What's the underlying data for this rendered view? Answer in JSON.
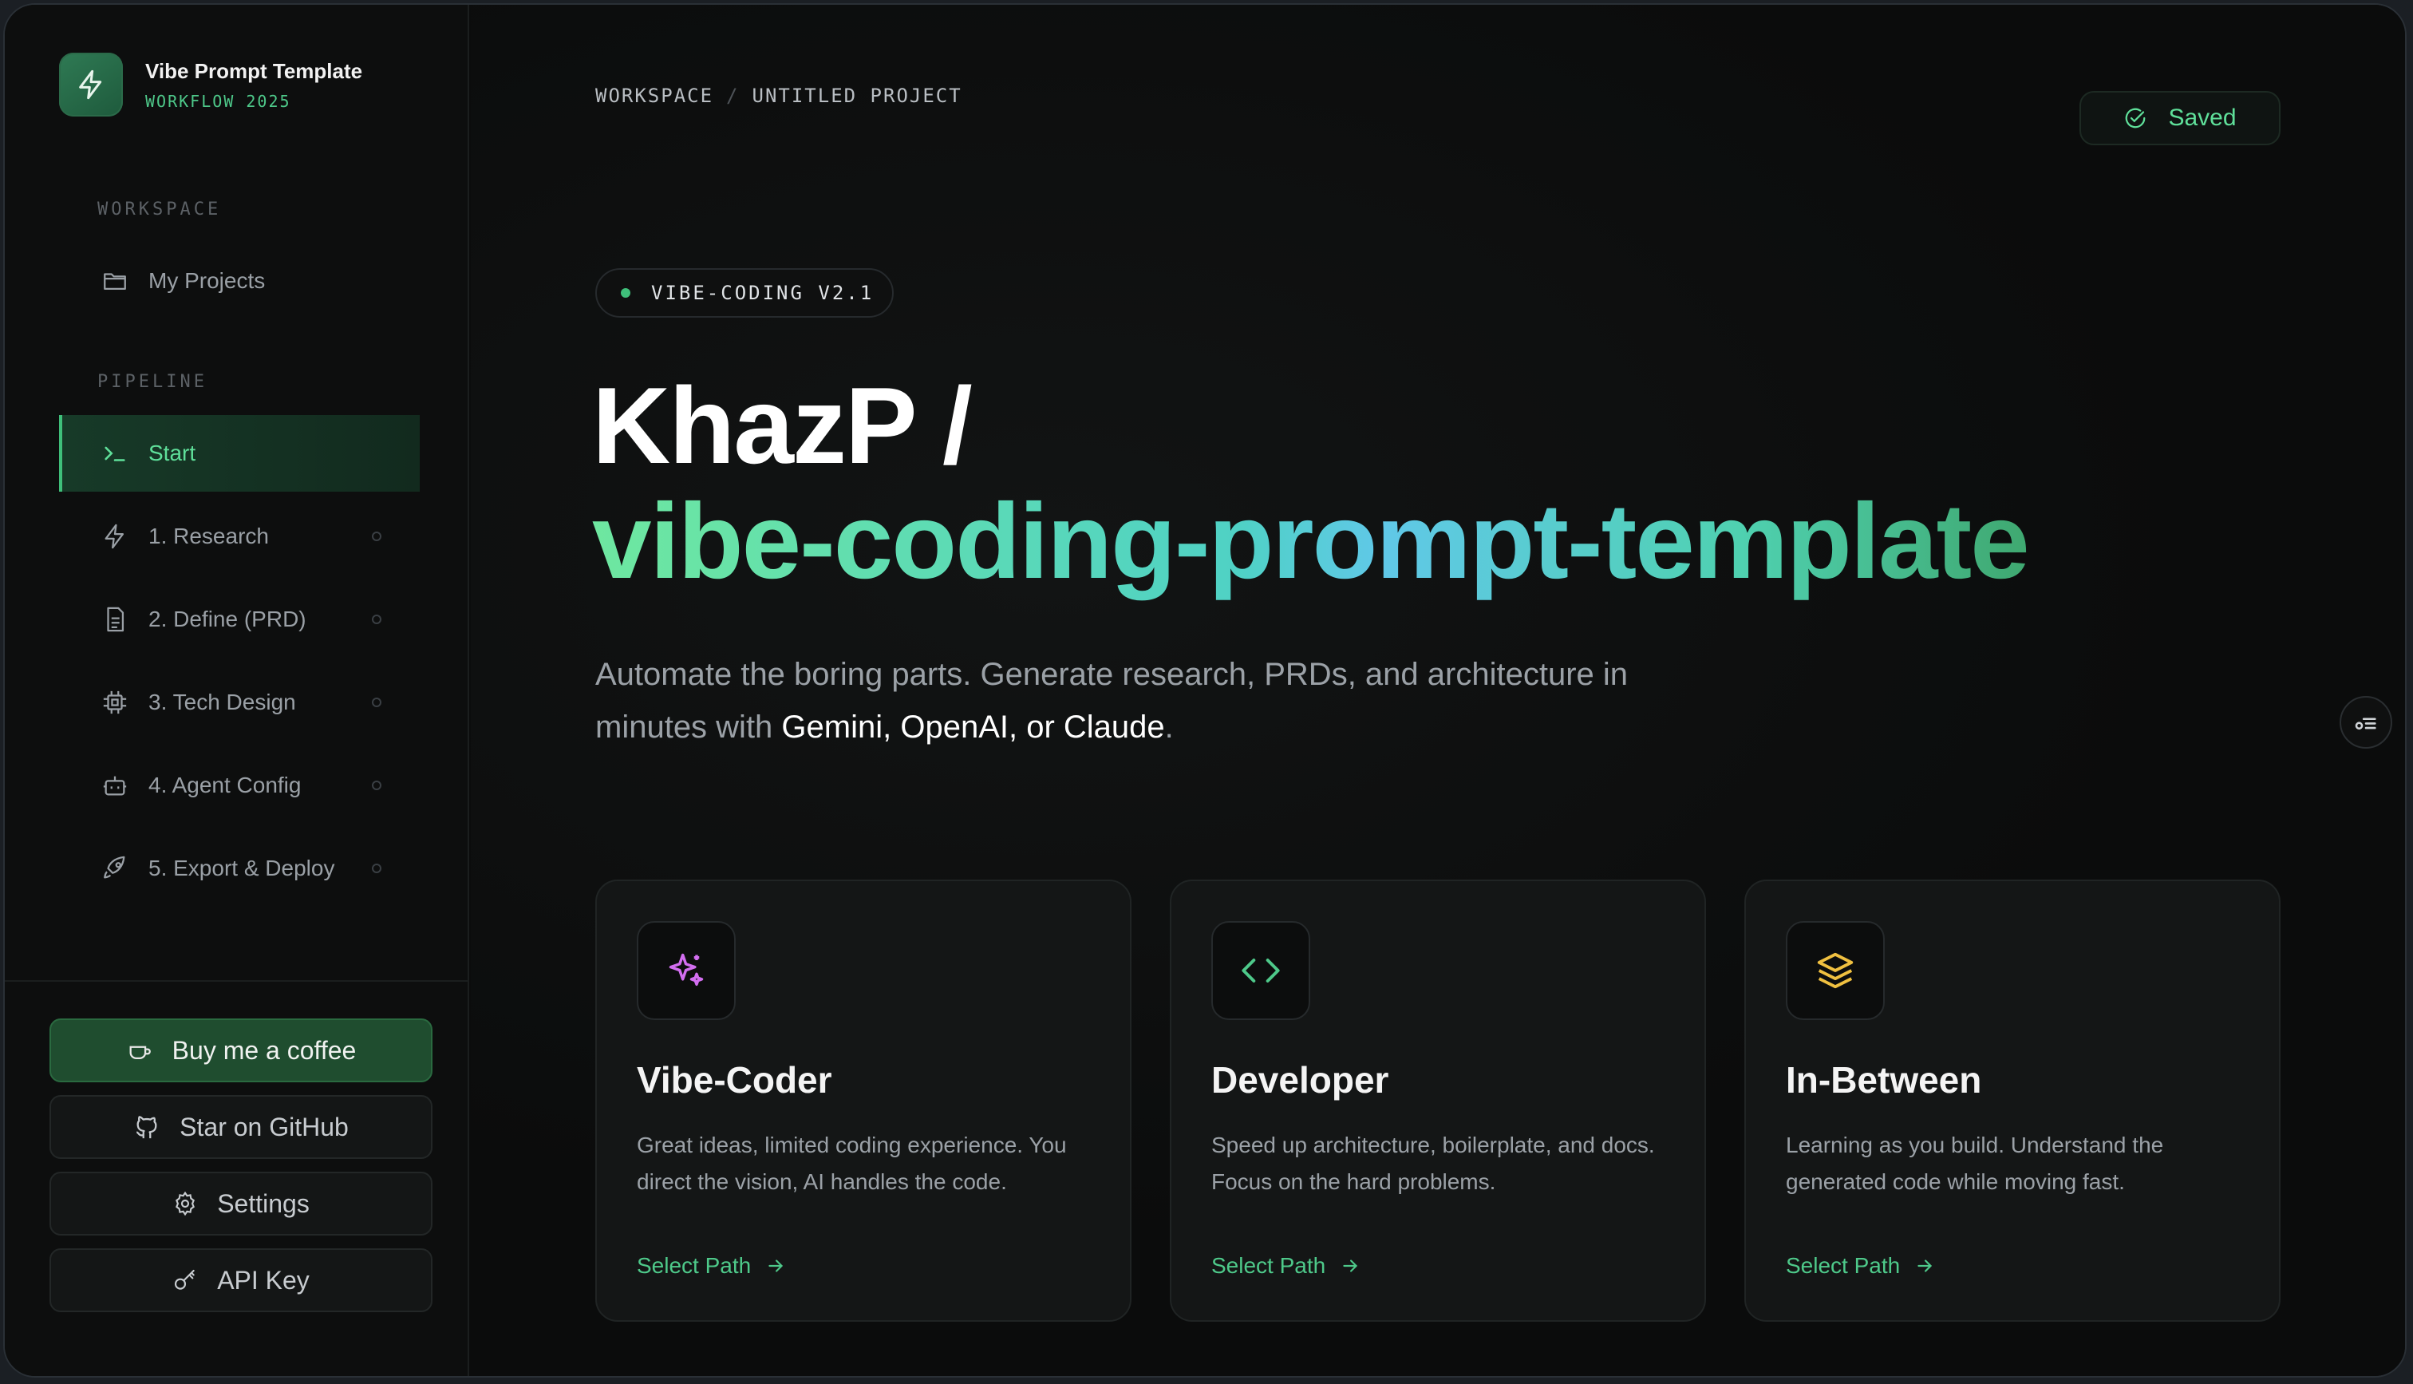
{
  "brand": {
    "title": "Vibe Prompt Template",
    "subtitle": "WORKFLOW 2025"
  },
  "sidebar": {
    "workspace_label": "WORKSPACE",
    "my_projects": "My Projects",
    "pipeline_label": "PIPELINE",
    "items": [
      {
        "label": "Start",
        "icon": "terminal-icon",
        "active": true
      },
      {
        "label": "1. Research",
        "icon": "bolt-icon"
      },
      {
        "label": "2. Define (PRD)",
        "icon": "document-icon"
      },
      {
        "label": "3. Tech Design",
        "icon": "chip-icon"
      },
      {
        "label": "4. Agent Config",
        "icon": "robot-icon"
      },
      {
        "label": "5. Export & Deploy",
        "icon": "rocket-icon"
      }
    ],
    "buttons": {
      "coffee": "Buy me a coffee",
      "github": "Star on GitHub",
      "settings": "Settings",
      "api_key": "API Key"
    }
  },
  "header": {
    "breadcrumb": [
      "WORKSPACE",
      "UNTITLED PROJECT"
    ],
    "saved": "Saved"
  },
  "hero": {
    "badge": "VIBE-CODING V2.1",
    "title_line1": "KhazP /",
    "title_line2": "vibe-coding-prompt-template",
    "lead_prefix": "Automate the boring parts. Generate research, PRDs, and architecture in minutes with ",
    "lead_strong": "Gemini, OpenAI, or Claude",
    "lead_suffix": "."
  },
  "cards": [
    {
      "title": "Vibe-Coder",
      "desc": "Great ideas, limited coding experience. You direct the vision, AI handles the code.",
      "link": "Select Path",
      "icon": "sparkles-icon",
      "color": "#d36ef0"
    },
    {
      "title": "Developer",
      "desc": "Speed up architecture, boilerplate, and docs. Focus on the hard problems.",
      "link": "Select Path",
      "icon": "code-icon",
      "color": "#4ec98a"
    },
    {
      "title": "In-Between",
      "desc": "Learning as you build. Understand the generated code while moving fast.",
      "link": "Select Path",
      "icon": "layers-icon",
      "color": "#f0c040"
    }
  ],
  "colors": {
    "accent": "#4ec98a",
    "background": "#0b0c0c"
  }
}
